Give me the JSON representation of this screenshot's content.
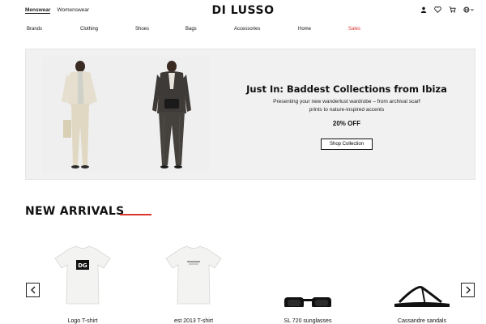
{
  "header": {
    "gender_tabs": [
      "Menswear",
      "Womenswear"
    ],
    "logo": "DI LUSSO",
    "icons": [
      "user-icon",
      "heart-icon",
      "cart-icon",
      "globe-icon"
    ]
  },
  "nav": {
    "items": [
      "Brands",
      "Clothing",
      "Shoes",
      "Bags",
      "Accessories",
      "Home",
      "Sales"
    ]
  },
  "hero": {
    "title": "Just In: Baddest Collections from Ibiza",
    "subtitle": "Presenting your new wanderlust wardrobe – from archival scarf prints to nature-inspired accents",
    "offer": "20% OFF",
    "cta": "Shop Collection"
  },
  "arrivals": {
    "title": "NEW ARRIVALS",
    "products": [
      {
        "name": "Logo T-shirt"
      },
      {
        "name": "est 2013 T-shirt"
      },
      {
        "name": "SL 720 sunglasses"
      },
      {
        "name": "Cassandre sandals"
      }
    ]
  },
  "colors": {
    "accent": "#d9352b",
    "hero_bg": "#f1f1f1",
    "text": "#111111"
  }
}
